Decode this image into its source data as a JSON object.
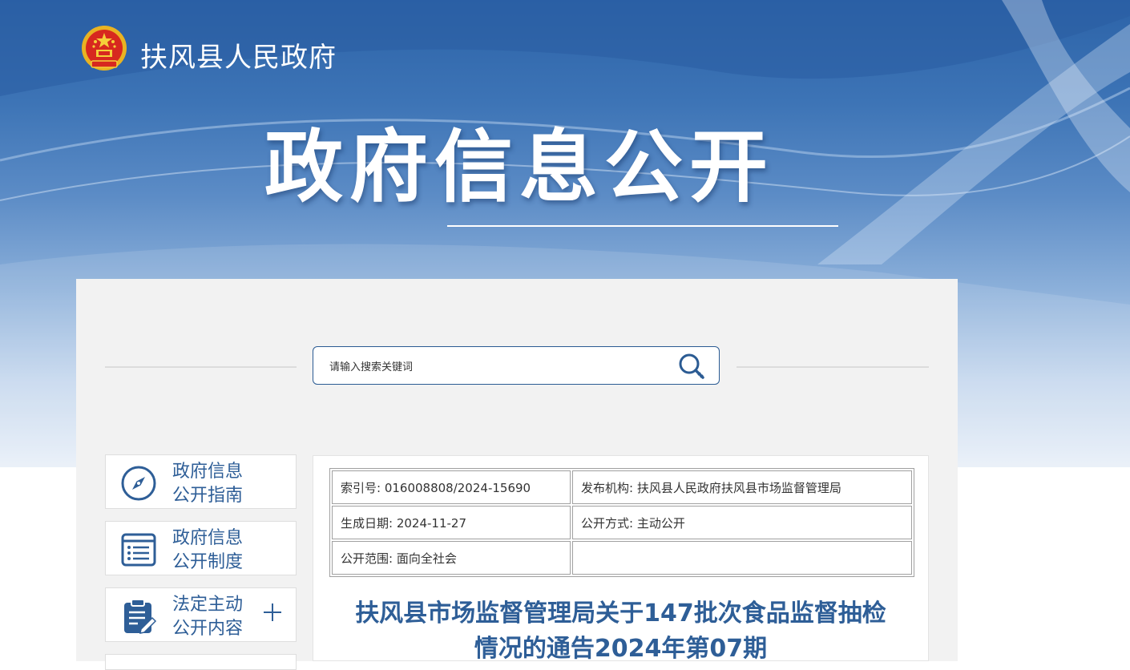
{
  "header": {
    "site_title": "扶风县人民政府",
    "hero_title": "政府信息公开"
  },
  "search": {
    "placeholder": "请输入搜索关键词",
    "button_icon": "search-icon"
  },
  "sidebar": {
    "items": [
      {
        "line1": "政府信息",
        "line2": "公开指南",
        "icon": "compass-icon"
      },
      {
        "line1": "政府信息",
        "line2": "公开制度",
        "icon": "list-document-icon"
      },
      {
        "line1": "法定主动",
        "line2": "公开内容",
        "icon": "clipboard-edit-icon",
        "expand": "plus-icon"
      }
    ]
  },
  "article": {
    "meta": {
      "index_no": "索引号: 016008808/2024-15690",
      "publisher": "发布机构: 扶风县人民政府扶风县市场监督管理局",
      "created_date": "生成日期: 2024-11-27",
      "disclosure_method": "公开方式: 主动公开",
      "disclosure_scope": "公开范围: 面向全社会",
      "empty_cell": ""
    },
    "title_line1": "扶风县市场监督管理局关于147批次食品监督抽检",
    "title_line2": "情况的通告2024年第07期"
  },
  "colors": {
    "accent_blue": "#2e5e97",
    "banner_blue": "#2c63a8",
    "panel_gray": "#f2f2f2"
  }
}
